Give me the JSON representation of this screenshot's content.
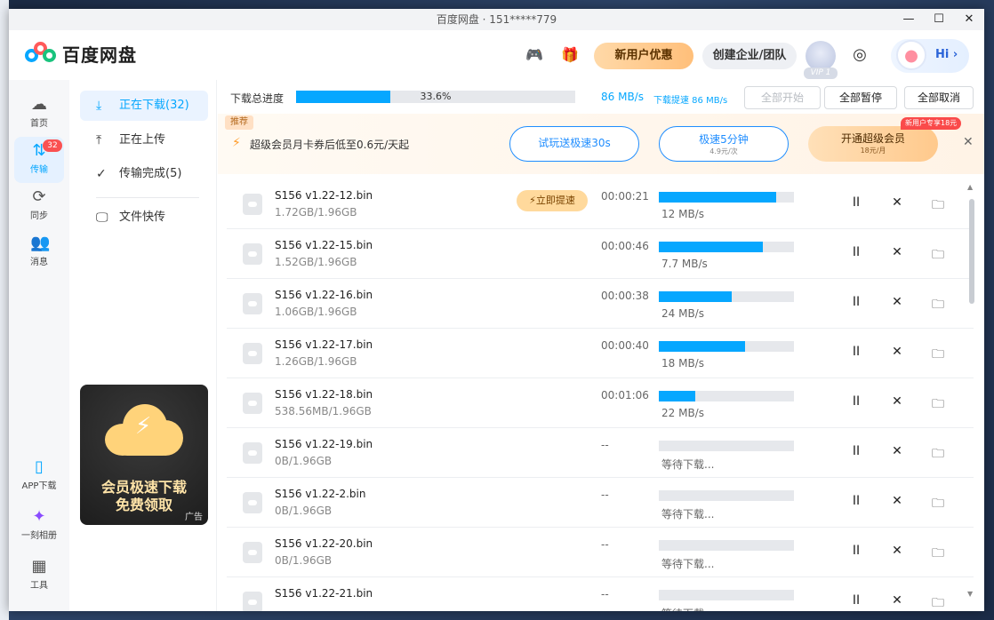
{
  "window": {
    "title": "百度网盘 · 151*****779",
    "minimize": "—",
    "maximize": "☐",
    "close": "✕"
  },
  "header": {
    "app_name": "百度网盘",
    "new_user_label": "新用户优惠",
    "team_label": "创建企业/团队",
    "vip_tag": "VIP 1",
    "hi_label": "Hi ›"
  },
  "rail": {
    "items": [
      {
        "label": "首页",
        "icon": "home-icon"
      },
      {
        "label": "传输",
        "icon": "transfer-icon",
        "badge": "32"
      },
      {
        "label": "同步",
        "icon": "sync-icon"
      },
      {
        "label": "消息",
        "icon": "message-icon"
      },
      {
        "label": "APP下载",
        "icon": "phone-icon"
      },
      {
        "label": "一刻相册",
        "icon": "album-icon"
      },
      {
        "label": "工具",
        "icon": "tools-icon"
      }
    ]
  },
  "side": {
    "items": [
      {
        "label": "正在下载(32)",
        "icon": "download-icon"
      },
      {
        "label": "正在上传",
        "icon": "upload-icon"
      },
      {
        "label": "传输完成(5)",
        "icon": "check-icon"
      },
      {
        "label": "文件快传",
        "icon": "monitor-icon"
      }
    ],
    "ad": {
      "line1": "会员极速下载",
      "line2": "免费领取",
      "tag": "广告"
    }
  },
  "progress": {
    "label": "下载总进度",
    "percent": 33.6,
    "percent_text": "33.6%",
    "speed": "86 MB/s",
    "boost_text": "下载提速 86 MB/s",
    "start_all": "全部开始",
    "pause_all": "全部暂停",
    "cancel_all": "全部取消"
  },
  "promo": {
    "tag": "推荐",
    "text": "超级会员月卡券后低至0.6元/天起",
    "trial": "试玩送极速30s",
    "speed_main": "极速5分钟",
    "speed_sub": "4.9元/次",
    "vip_main": "开通超级会员",
    "vip_sub": "18元/月",
    "new_user_badge": "新用户专享18元"
  },
  "downloads": [
    {
      "name": "S156 v1.22-12.bin",
      "size": "1.72GB/1.96GB",
      "time": "00:00:21",
      "progress": 0.87,
      "speed": "12 MB/s",
      "boost": "⚡立即提速"
    },
    {
      "name": "S156 v1.22-15.bin",
      "size": "1.52GB/1.96GB",
      "time": "00:00:46",
      "progress": 0.77,
      "speed": "7.7 MB/s"
    },
    {
      "name": "S156 v1.22-16.bin",
      "size": "1.06GB/1.96GB",
      "time": "00:00:38",
      "progress": 0.54,
      "speed": "24 MB/s"
    },
    {
      "name": "S156 v1.22-17.bin",
      "size": "1.26GB/1.96GB",
      "time": "00:00:40",
      "progress": 0.64,
      "speed": "18 MB/s"
    },
    {
      "name": "S156 v1.22-18.bin",
      "size": "538.56MB/1.96GB",
      "time": "00:01:06",
      "progress": 0.27,
      "speed": "22 MB/s"
    },
    {
      "name": "S156 v1.22-19.bin",
      "size": "0B/1.96GB",
      "time": "--",
      "progress": 0,
      "speed": "等待下载..."
    },
    {
      "name": "S156 v1.22-2.bin",
      "size": "0B/1.96GB",
      "time": "--",
      "progress": 0,
      "speed": "等待下载..."
    },
    {
      "name": "S156 v1.22-20.bin",
      "size": "0B/1.96GB",
      "time": "--",
      "progress": 0,
      "speed": "等待下载..."
    },
    {
      "name": "S156 v1.22-21.bin",
      "size": "",
      "time": "--",
      "progress": 0,
      "speed": "等待下载..."
    }
  ],
  "row_actions": {
    "pause": "II",
    "cancel": "✕",
    "folder": "🗀"
  },
  "colors": {
    "accent": "#06a7ff",
    "badge": "#fa5151",
    "vip": "#ffc98c"
  }
}
